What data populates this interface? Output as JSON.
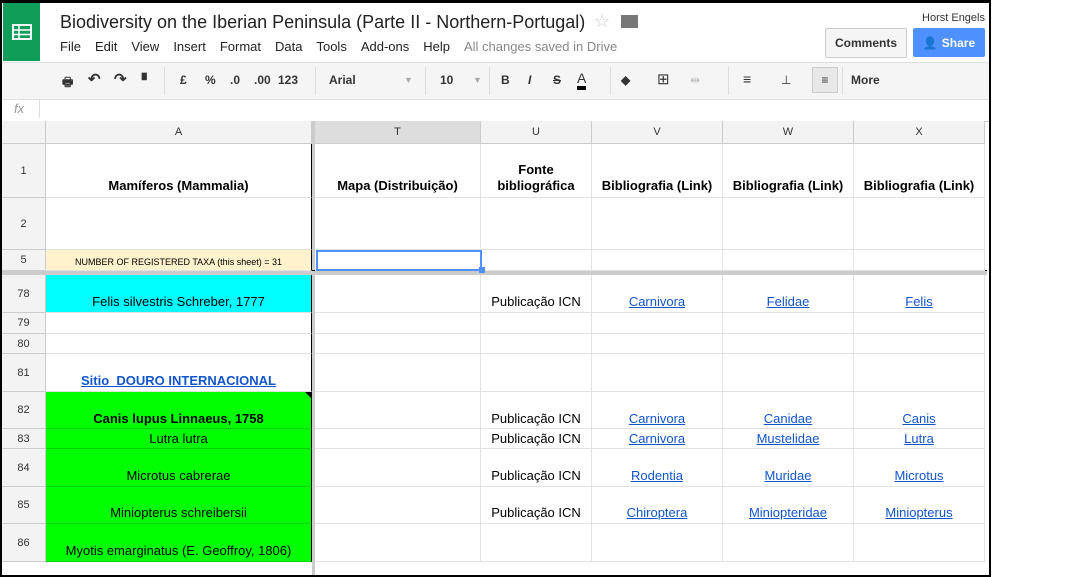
{
  "app": {
    "title": "Biodiversity on the Iberian Peninsula (Parte II - Northern-Portugal)",
    "user": "Horst Engels",
    "comments": "Comments",
    "share": "Share",
    "saved_status": "All changes saved in Drive"
  },
  "menu": [
    "File",
    "Edit",
    "View",
    "Insert",
    "Format",
    "Data",
    "Tools",
    "Add-ons",
    "Help"
  ],
  "toolbar": {
    "currency": "£",
    "percent": "%",
    "dec_less": ".0",
    "dec_more": ".00",
    "format": "123",
    "font": "Arial",
    "size": "10",
    "bold": "B",
    "italic": "I",
    "strike": "S",
    "text_color": "A",
    "more": "More"
  },
  "formula_bar": {
    "fx": "fx",
    "value": ""
  },
  "columns": [
    "A",
    "T",
    "U",
    "V",
    "W",
    "X"
  ],
  "rows": [
    {
      "n": "1",
      "cells": [
        "Mamíferos (Mammalia)",
        "Mapa (Distribuição)",
        "Fonte bibliográfica",
        "Bibliografia (Link)",
        "Bibliografia (Link)",
        "Bibliografia (Link)"
      ]
    },
    {
      "n": "2",
      "cells": [
        "",
        "",
        "",
        "",
        "",
        ""
      ]
    },
    {
      "n": "5",
      "cells": [
        "NUMBER OF REGISTERED TAXA (this sheet)  = 31",
        "",
        "",
        "",
        "",
        ""
      ]
    },
    {
      "n": "78",
      "cells": [
        "Felis silvestris Schreber, 1777",
        "",
        "Publicação ICN",
        "Carnivora",
        "Felidae",
        "Felis"
      ]
    },
    {
      "n": "79",
      "cells": [
        "",
        "",
        "",
        "",
        "",
        ""
      ]
    },
    {
      "n": "80",
      "cells": [
        "",
        "",
        "",
        "",
        "",
        ""
      ]
    },
    {
      "n": "81",
      "cells": [
        "Sitio_DOURO INTERNACIONAL",
        "",
        "",
        "",
        "",
        ""
      ]
    },
    {
      "n": "82",
      "cells": [
        "Canis lupus Linnaeus, 1758",
        "",
        "Publicação ICN",
        "Carnivora",
        "Canidae",
        "Canis"
      ]
    },
    {
      "n": "83",
      "cells": [
        "Lutra lutra",
        "",
        "Publicação ICN",
        "Carnivora",
        "Mustelidae",
        "Lutra"
      ]
    },
    {
      "n": "84",
      "cells": [
        "Microtus cabrerae",
        "",
        "Publicação ICN",
        "Rodentia",
        "Muridae",
        "Microtus"
      ]
    },
    {
      "n": "85",
      "cells": [
        "Miniopterus schreibersii",
        "",
        "Publicação ICN",
        "Chiroptera",
        "Miniopteridae",
        "Miniopterus"
      ]
    },
    {
      "n": "86",
      "cells": [
        "Myotis emarginatus (E. Geoffroy, 1806)",
        "",
        "",
        "",
        "",
        ""
      ]
    }
  ],
  "colors": {
    "cyan": "#00ffff",
    "green": "#00ff00",
    "highlight": "#fff2cc",
    "link": "#1155cc",
    "share": "#4d90fe"
  }
}
